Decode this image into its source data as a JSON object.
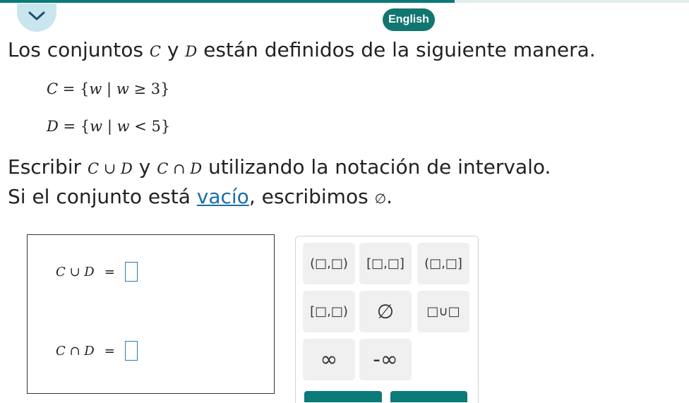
{
  "progress": 0.66,
  "header": {
    "language_label": "English"
  },
  "problem": {
    "intro_prefix": "Los conjuntos",
    "set_c": "C",
    "conj_y": "y",
    "set_d": "D",
    "intro_suffix": "están definidos de la siguiente manera.",
    "def_c": {
      "name": "C",
      "eq": " = {",
      "var": "w",
      "bar": " | ",
      "var2": "w",
      "rel": " ≥ 3}"
    },
    "def_d": {
      "name": "D",
      "eq": " = {",
      "var": "w",
      "bar": " | ",
      "var2": "w",
      "rel": " < 5}"
    },
    "instr_prefix": "Escribir",
    "union_expr": "C ∪ D",
    "instr_y": "y",
    "inter_expr": "C ∩ D",
    "instr_suffix": "utilizando la notación de intervalo.",
    "empty_prefix": "Si el conjunto está",
    "empty_link": "vacío",
    "empty_middle": ", escribimos",
    "empty_symbol": "∅",
    "empty_end": "."
  },
  "answer": {
    "union_label": "C ∪ D",
    "inter_label": "C ∩ D",
    "equals": "="
  },
  "keypad": {
    "open_open": "(□,□)",
    "closed_closed": "[□,□]",
    "open_closed": "(□,□]",
    "closed_open": "[□,□)",
    "empty_set": "∅",
    "union": "□∪□",
    "infinity": "∞",
    "neg_infinity": "-∞"
  },
  "colors": {
    "accent": "#0b7a78",
    "button": "#117670",
    "link": "#1b6fa6"
  }
}
